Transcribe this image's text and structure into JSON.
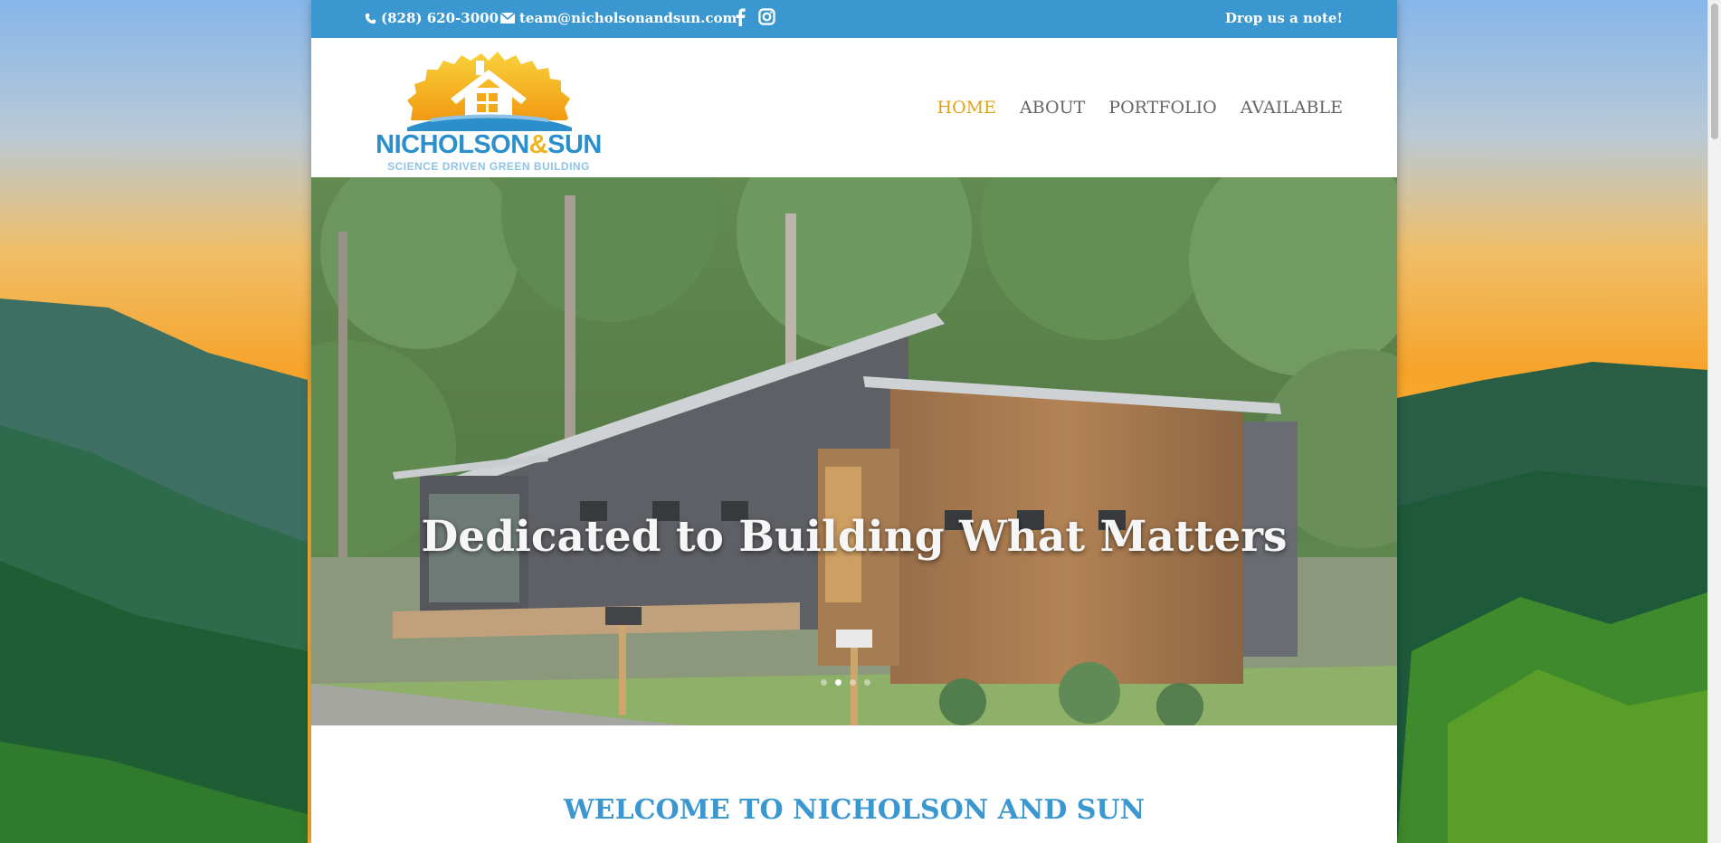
{
  "topbar": {
    "phone": "(828) 620-3000",
    "email": "team@nicholsonandsun.com",
    "social_icons": [
      "facebook-icon",
      "instagram-icon"
    ],
    "cta": "Drop us a note!"
  },
  "logo": {
    "name_part1": "NICHOLSON",
    "name_amp": "&",
    "name_part2": "SUN",
    "tagline": "SCIENCE DRIVEN GREEN BUILDING"
  },
  "nav": {
    "items": [
      "HOME",
      "ABOUT",
      "PORTFOLIO",
      "AVAILABLE"
    ],
    "active": "HOME"
  },
  "hero": {
    "title": "Dedicated to Building What Matters",
    "slide_count": 4,
    "active_slide": 2
  },
  "welcome": {
    "heading": "WELCOME TO NICHOLSON AND SUN"
  },
  "colors": {
    "topbar_bg": "#3b97cf",
    "nav_active": "#e0a21b",
    "nav_text": "#666666",
    "heading_blue": "#3b97cf",
    "logo_blue": "#2b8fcc",
    "logo_yellow": "#f0b323"
  }
}
